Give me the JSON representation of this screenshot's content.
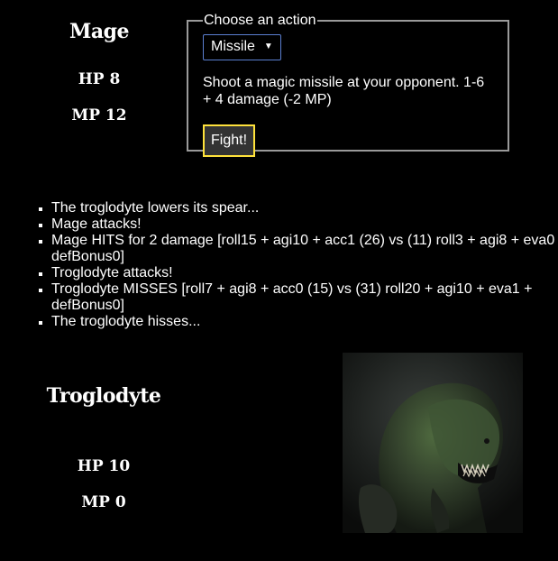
{
  "player": {
    "name": "Mage",
    "hp": "HP 8",
    "mp": "MP 12"
  },
  "action": {
    "legend": "Choose an action",
    "selected": "Missile",
    "description": "Shoot a magic missile at your opponent. 1-6 + 4 damage (-2 MP)",
    "fight_label": "Fight!",
    "colors": {
      "select_border": "#5b7fd1",
      "fight_border": "#ffe23b",
      "fight_bg": "#333333"
    }
  },
  "log": [
    "The troglodyte lowers its spear...",
    "Mage attacks!",
    "Mage HITS for 2 damage [roll15 + agi10 + acc1 (26) vs (11) roll3 + agi8 + eva0 + defBonus0]",
    "Troglodyte attacks!",
    "Troglodyte MISSES [roll7 + agi8 + acc0 (15) vs (31) roll20 + agi10 + eva1 + defBonus0]",
    "The troglodyte hisses..."
  ],
  "enemy": {
    "name": "Troglodyte",
    "hp": "HP 10",
    "mp": "MP 0",
    "portrait_icon": "troglodyte-portrait"
  }
}
